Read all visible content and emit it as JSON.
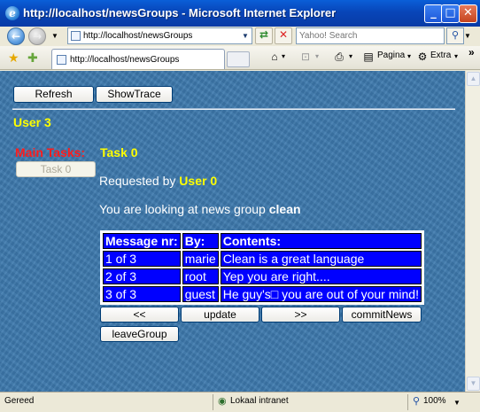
{
  "window": {
    "title": "http://localhost/newsGroups - Microsoft Internet Explorer",
    "buttons": {
      "minimize": "_",
      "maximize": "□",
      "close": "✕"
    }
  },
  "toolbar": {
    "address": "http://localhost/newsGroups",
    "search_placeholder": "Yahoo! Search",
    "tab_title": "http://localhost/newsGroups",
    "commands": {
      "page": "Pagina",
      "extra": "Extra"
    },
    "overflow": "»"
  },
  "page": {
    "buttons": {
      "refresh": "Refresh",
      "show_trace": "ShowTrace"
    },
    "user_heading": "User 3",
    "main_tasks_label": "Main Tasks:",
    "task_button": "Task 0",
    "task_title": "Task 0",
    "requested_by_label": "Requested by",
    "requested_by_user": "User 0",
    "looking_at_label": "You are looking at news group",
    "news_group": "clean",
    "table": {
      "headers": [
        "Message nr:",
        "By:",
        "Contents:"
      ],
      "rows": [
        [
          "1 of 3",
          "marie",
          "Clean is a great language"
        ],
        [
          "2 of 3",
          "root",
          "Yep you are right...."
        ],
        [
          "3 of 3",
          "guest",
          "He guy's□ you are out of your mind!"
        ]
      ]
    },
    "nav_buttons": {
      "prev": "<<",
      "update": "update",
      "next": ">>",
      "commit": "commitNews",
      "leave": "leaveGroup"
    }
  },
  "statusbar": {
    "status": "Gereed",
    "zone": "Lokaal intranet",
    "zoom": "100%"
  },
  "colors": {
    "page_background": "#3d79ad",
    "highlight_text": "#ffff00",
    "alert_text": "#ff1c1c",
    "table_cell": "#0000ff"
  }
}
